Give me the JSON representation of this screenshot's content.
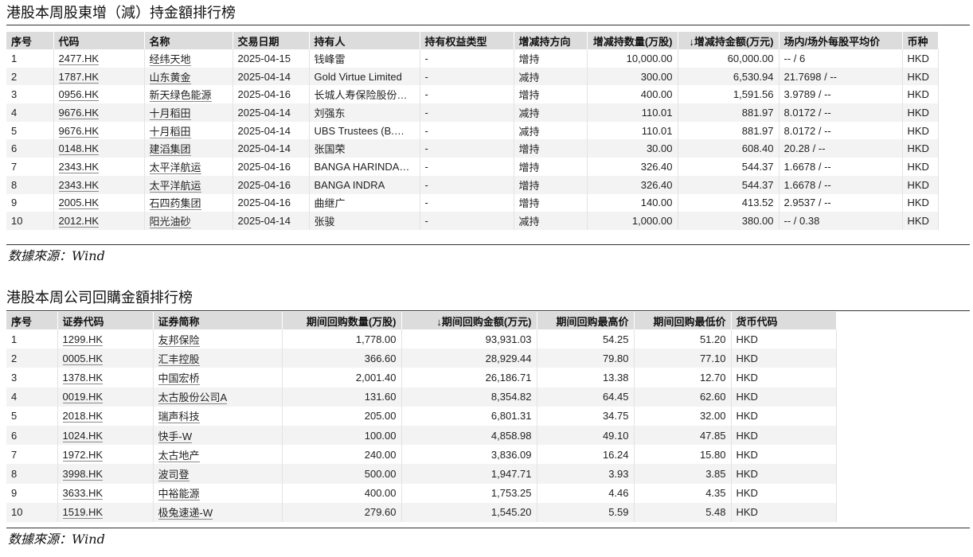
{
  "section1": {
    "title": "港股本周股東增（減）持金額排行榜",
    "columns": [
      "序号",
      "代码",
      "名称",
      "交易日期",
      "持有人",
      "持有权益类型",
      "增减持方向",
      "增减持数量(万股)",
      "↓增减持金额(万元)",
      "场内/场外每股平均价",
      "币种"
    ],
    "rows": [
      [
        "1",
        "2477.HK",
        "经纬天地",
        "2025-04-15",
        "钱峰雷",
        "-",
        "增持",
        "10,000.00",
        "60,000.00",
        "-- / 6",
        "HKD"
      ],
      [
        "2",
        "1787.HK",
        "山东黄金",
        "2025-04-14",
        "Gold Virtue Limited",
        "-",
        "减持",
        "300.00",
        "6,530.94",
        "21.7698 / --",
        "HKD"
      ],
      [
        "3",
        "0956.HK",
        "新天绿色能源",
        "2025-04-16",
        "长城人寿保险股份…",
        "-",
        "增持",
        "400.00",
        "1,591.56",
        "3.9789 / --",
        "HKD"
      ],
      [
        "4",
        "9676.HK",
        "十月稻田",
        "2025-04-14",
        "刘强东",
        "-",
        "减持",
        "110.01",
        "881.97",
        "8.0172 / --",
        "HKD"
      ],
      [
        "5",
        "9676.HK",
        "十月稻田",
        "2025-04-14",
        "UBS Trustees (B.…",
        "-",
        "减持",
        "110.01",
        "881.97",
        "8.0172 / --",
        "HKD"
      ],
      [
        "6",
        "0148.HK",
        "建滔集团",
        "2025-04-14",
        "张国荣",
        "-",
        "增持",
        "30.00",
        "608.40",
        "20.28 / --",
        "HKD"
      ],
      [
        "7",
        "2343.HK",
        "太平洋航运",
        "2025-04-16",
        "BANGA HARINDA…",
        "-",
        "增持",
        "326.40",
        "544.37",
        "1.6678 / --",
        "HKD"
      ],
      [
        "8",
        "2343.HK",
        "太平洋航运",
        "2025-04-16",
        "BANGA INDRA",
        "-",
        "增持",
        "326.40",
        "544.37",
        "1.6678 / --",
        "HKD"
      ],
      [
        "9",
        "2005.HK",
        "石四药集团",
        "2025-04-16",
        "曲继广",
        "-",
        "增持",
        "140.00",
        "413.52",
        "2.9537 / --",
        "HKD"
      ],
      [
        "10",
        "2012.HK",
        "阳光油砂",
        "2025-04-14",
        "张骏",
        "-",
        "减持",
        "1,000.00",
        "380.00",
        "-- / 0.38",
        "HKD"
      ]
    ],
    "source": "数據來源：Wind"
  },
  "section2": {
    "title": "港股本周公司回購金額排行榜",
    "columns": [
      "序号",
      "证券代码",
      "证券简称",
      "期间回购数量(万股)",
      "↓期间回购金额(万元)",
      "期间回购最高价",
      "期间回购最低价",
      "货币代码"
    ],
    "rows": [
      [
        "1",
        "1299.HK",
        "友邦保险",
        "1,778.00",
        "93,931.03",
        "54.25",
        "51.20",
        "HKD"
      ],
      [
        "2",
        "0005.HK",
        "汇丰控股",
        "366.60",
        "28,929.44",
        "79.80",
        "77.10",
        "HKD"
      ],
      [
        "3",
        "1378.HK",
        "中国宏桥",
        "2,001.40",
        "26,186.71",
        "13.38",
        "12.70",
        "HKD"
      ],
      [
        "4",
        "0019.HK",
        "太古股份公司A",
        "131.60",
        "8,354.82",
        "64.45",
        "62.60",
        "HKD"
      ],
      [
        "5",
        "2018.HK",
        "瑞声科技",
        "205.00",
        "6,801.31",
        "34.75",
        "32.00",
        "HKD"
      ],
      [
        "6",
        "1024.HK",
        "快手-W",
        "100.00",
        "4,858.98",
        "49.10",
        "47.85",
        "HKD"
      ],
      [
        "7",
        "1972.HK",
        "太古地产",
        "240.00",
        "3,836.09",
        "16.24",
        "15.80",
        "HKD"
      ],
      [
        "8",
        "3998.HK",
        "波司登",
        "500.00",
        "1,947.71",
        "3.93",
        "3.85",
        "HKD"
      ],
      [
        "9",
        "3633.HK",
        "中裕能源",
        "400.00",
        "1,753.25",
        "4.46",
        "4.35",
        "HKD"
      ],
      [
        "10",
        "1519.HK",
        "极兔速递-W",
        "279.60",
        "1,545.20",
        "5.59",
        "5.48",
        "HKD"
      ]
    ],
    "source": "数據來源：Wind"
  }
}
